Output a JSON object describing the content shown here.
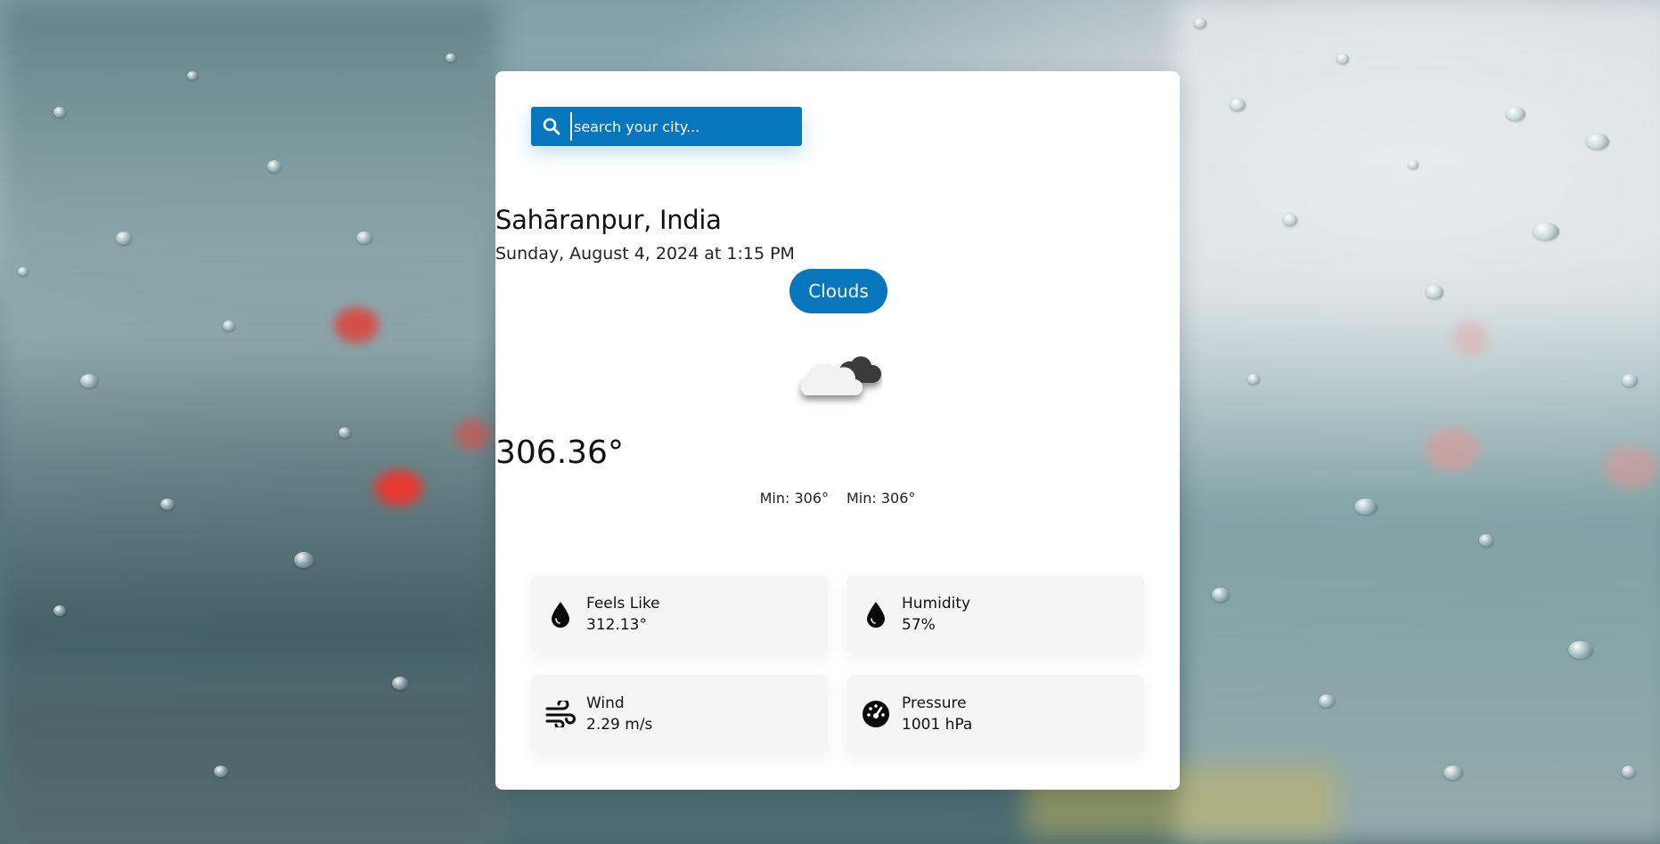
{
  "search": {
    "placeholder": "search your city..."
  },
  "location": {
    "city": "Sahāranpur, India",
    "datetime": "Sunday, August 4, 2024 at 1:15 PM"
  },
  "weather": {
    "condition": "Clouds",
    "icon": "clouds-icon",
    "temperature": "306.36°",
    "min_label_1": "Min: 306°",
    "min_label_2": "Min: 306°"
  },
  "stats": {
    "feels_like": {
      "label": "Feels Like",
      "value": "312.13°",
      "icon": "droplet-icon"
    },
    "humidity": {
      "label": "Humidity",
      "value": "57%",
      "icon": "droplet-icon"
    },
    "wind": {
      "label": "Wind",
      "value": "2.29 m/s",
      "icon": "wind-icon"
    },
    "pressure": {
      "label": "Pressure",
      "value": "1001 hPa",
      "icon": "gauge-icon"
    }
  },
  "colors": {
    "accent": "#0776bd",
    "card": "#ffffff",
    "stat_card": "#f5f5f5"
  }
}
